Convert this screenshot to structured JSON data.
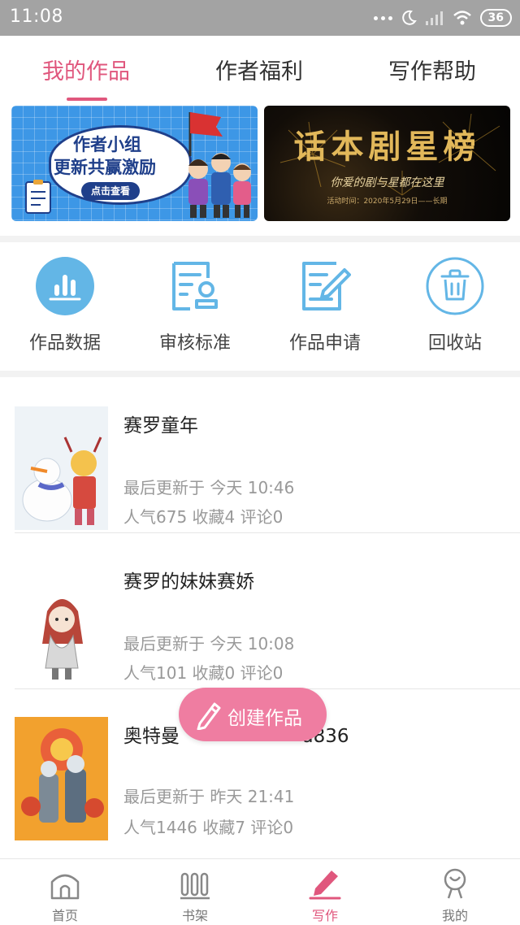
{
  "status_bar": {
    "time": "11:08",
    "battery": "36"
  },
  "tabs": [
    {
      "label": "我的作品",
      "active": true
    },
    {
      "label": "作者福利",
      "active": false
    },
    {
      "label": "写作帮助",
      "active": false
    }
  ],
  "banners": {
    "left": {
      "line1": "作者小组",
      "line2": "更新共赢激励",
      "button": "点击查看"
    },
    "right": {
      "title": "话本剧星榜",
      "subtitle": "你爱的剧与星都在这里",
      "note": "活动时间：2020年5月29日——长期"
    }
  },
  "features": [
    {
      "label": "作品数据",
      "icon": "chart-icon"
    },
    {
      "label": "审核标准",
      "icon": "review-icon"
    },
    {
      "label": "作品申请",
      "icon": "edit-document-icon"
    },
    {
      "label": "回收站",
      "icon": "trash-icon"
    }
  ],
  "works": [
    {
      "title": "赛罗童年",
      "updated": "最后更新于 今天 10:46",
      "stats": "人气675  收藏4  评论0"
    },
    {
      "title": "赛罗的妹妹赛娇",
      "updated": "最后更新于 今天 10:08",
      "stats": "人气101  收藏0  评论0"
    },
    {
      "title": "奥特曼",
      "title_suffix": "d836",
      "updated": "最后更新于 昨天 21:41",
      "stats": "人气1446  收藏7  评论0"
    }
  ],
  "create_button": "创建作品",
  "bottom_nav": [
    {
      "label": "首页",
      "active": false
    },
    {
      "label": "书架",
      "active": false
    },
    {
      "label": "写作",
      "active": true
    },
    {
      "label": "我的",
      "active": false
    }
  ],
  "colors": {
    "accent": "#e0577d",
    "icon_blue": "#63b6e6",
    "create_pink": "#ef7da1",
    "status_bar": "#a3a3a3"
  }
}
